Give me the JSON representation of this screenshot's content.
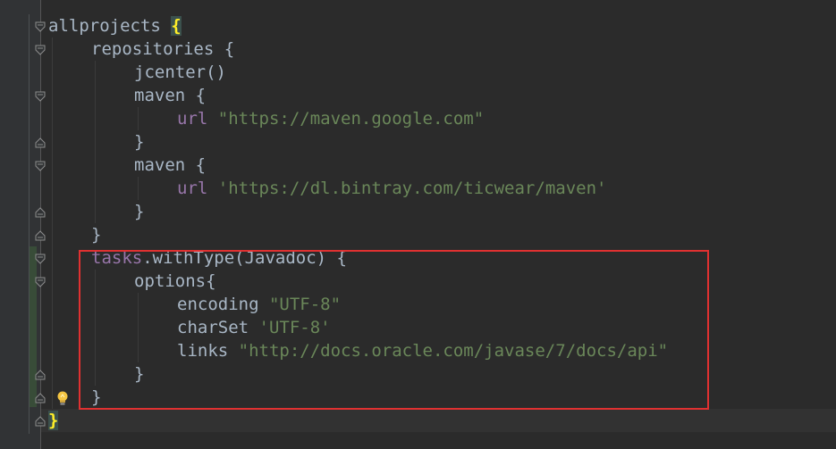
{
  "editor": {
    "lines": [
      {
        "indent": 0,
        "tokens": [
          {
            "t": "allprojects ",
            "c": "id"
          },
          {
            "t": "{",
            "c": "brace-hl"
          }
        ]
      },
      {
        "indent": 1,
        "tokens": [
          {
            "t": "repositories {",
            "c": "id"
          }
        ]
      },
      {
        "indent": 2,
        "tokens": [
          {
            "t": "jcenter()",
            "c": "id"
          }
        ]
      },
      {
        "indent": 2,
        "tokens": [
          {
            "t": "maven {",
            "c": "id"
          }
        ]
      },
      {
        "indent": 3,
        "tokens": [
          {
            "t": "url ",
            "c": "prop"
          },
          {
            "t": "\"https://maven.google.com\"",
            "c": "str"
          }
        ]
      },
      {
        "indent": 2,
        "tokens": [
          {
            "t": "}",
            "c": "id"
          }
        ]
      },
      {
        "indent": 2,
        "tokens": [
          {
            "t": "maven {",
            "c": "id"
          }
        ]
      },
      {
        "indent": 3,
        "tokens": [
          {
            "t": "url ",
            "c": "prop"
          },
          {
            "t": "'https://dl.bintray.com/ticwear/maven'",
            "c": "str"
          }
        ]
      },
      {
        "indent": 2,
        "tokens": [
          {
            "t": "}",
            "c": "id"
          }
        ]
      },
      {
        "indent": 1,
        "tokens": [
          {
            "t": "}",
            "c": "id"
          }
        ]
      },
      {
        "indent": 1,
        "tokens": [
          {
            "t": "tasks",
            "c": "prop"
          },
          {
            "t": ".withType(Javadoc) {",
            "c": "id"
          }
        ]
      },
      {
        "indent": 2,
        "tokens": [
          {
            "t": "options{",
            "c": "id"
          }
        ]
      },
      {
        "indent": 3,
        "tokens": [
          {
            "t": "encoding ",
            "c": "id"
          },
          {
            "t": "\"UTF-8\"",
            "c": "str"
          }
        ]
      },
      {
        "indent": 3,
        "tokens": [
          {
            "t": "charSet ",
            "c": "id"
          },
          {
            "t": "'UTF-8'",
            "c": "str"
          }
        ]
      },
      {
        "indent": 3,
        "tokens": [
          {
            "t": "links ",
            "c": "id"
          },
          {
            "t": "\"http://docs.oracle.com/javase/7/docs/api\"",
            "c": "str"
          }
        ]
      },
      {
        "indent": 2,
        "tokens": [
          {
            "t": "}",
            "c": "id"
          }
        ]
      },
      {
        "indent": 1,
        "tokens": [
          {
            "t": "}",
            "c": "id"
          }
        ]
      },
      {
        "indent": 0,
        "tokens": [
          {
            "t": "}",
            "c": "brace-hl"
          }
        ]
      }
    ],
    "folds": [
      {
        "line": 0,
        "kind": "open"
      },
      {
        "line": 1,
        "kind": "open"
      },
      {
        "line": 3,
        "kind": "open"
      },
      {
        "line": 5,
        "kind": "close"
      },
      {
        "line": 6,
        "kind": "open"
      },
      {
        "line": 8,
        "kind": "close"
      },
      {
        "line": 9,
        "kind": "close"
      },
      {
        "line": 10,
        "kind": "open"
      },
      {
        "line": 11,
        "kind": "open"
      },
      {
        "line": 15,
        "kind": "close"
      },
      {
        "line": 16,
        "kind": "close"
      },
      {
        "line": 17,
        "kind": "close"
      }
    ],
    "bulb_icon": "lightbulb-icon",
    "colors": {
      "background": "#2b2b2b",
      "identifier": "#a9b7c6",
      "string": "#6a8759",
      "property": "#9876aa",
      "matched_brace": "#ffef28",
      "annotation_box": "#e03131"
    }
  }
}
